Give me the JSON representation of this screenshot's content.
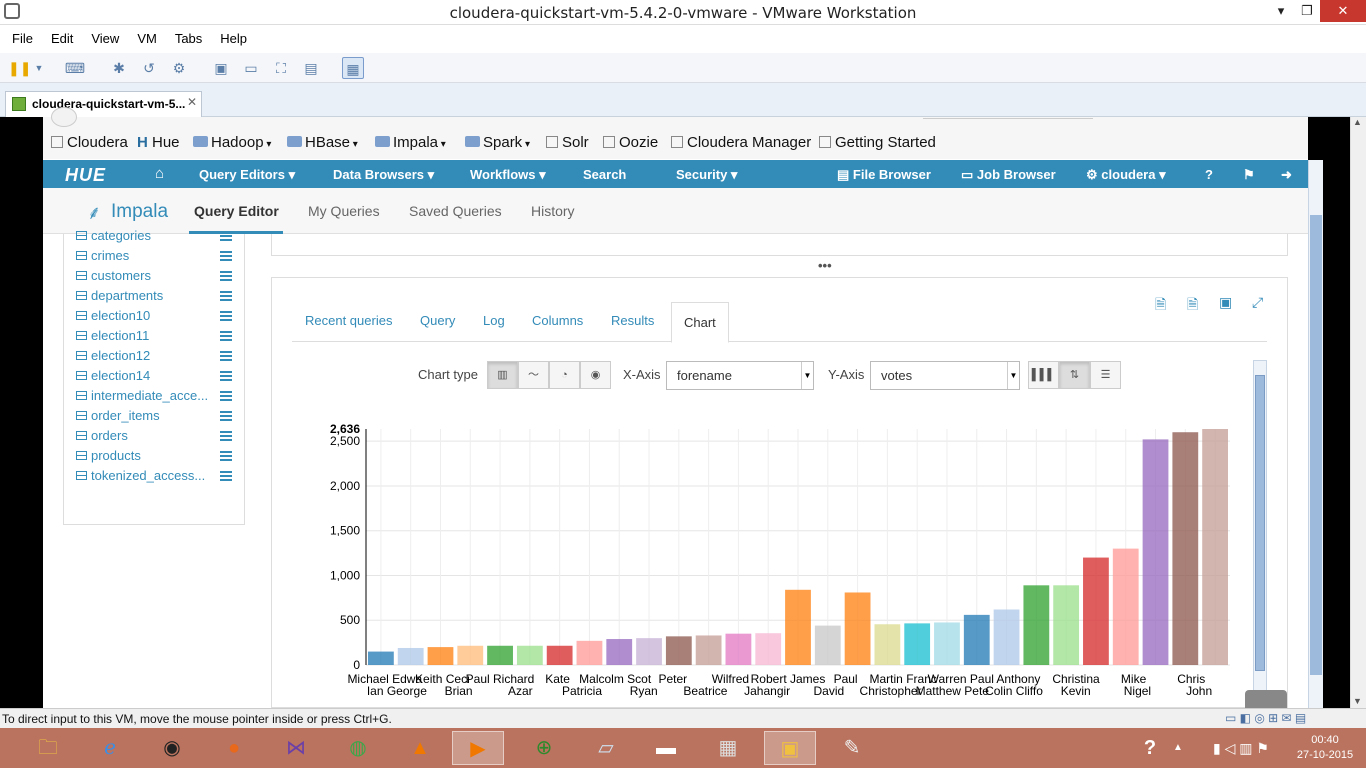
{
  "window": {
    "title": "cloudera-quickstart-vm-5.4.2-0-vmware - VMware Workstation",
    "minimize": "▾",
    "maximize": "❐",
    "close": "✕"
  },
  "menu": [
    "File",
    "Edit",
    "View",
    "VM",
    "Tabs",
    "Help"
  ],
  "vm_tab": {
    "label": "cloudera-quickstart-vm-5...",
    "close": "✕"
  },
  "bookmarks": [
    "Cloudera",
    "Hue",
    "Hadoop",
    "HBase",
    "Impala",
    "Spark",
    "Solr",
    "Oozie",
    "Cloudera Manager",
    "Getting Started"
  ],
  "hue_nav": {
    "logo": "HUE",
    "query_editors": "Query Editors ▾",
    "data_browsers": "Data Browsers ▾",
    "workflows": "Workflows ▾",
    "search": "Search",
    "security": "Security ▾",
    "file_browser": "File Browser",
    "job_browser": "Job Browser",
    "user": "cloudera ▾",
    "help": "?"
  },
  "sub_nav": {
    "app": "Impala",
    "query_editor": "Query Editor",
    "my_queries": "My Queries",
    "saved_queries": "Saved Queries",
    "history": "History"
  },
  "tables": [
    "categories",
    "crimes",
    "customers",
    "departments",
    "election10",
    "election11",
    "election12",
    "election14",
    "intermediate_acce...",
    "order_items",
    "orders",
    "products",
    "tokenized_access..."
  ],
  "result_tabs": [
    "Recent queries",
    "Query",
    "Log",
    "Columns",
    "Results",
    "Chart"
  ],
  "chart_controls": {
    "chart_type_label": "Chart type",
    "xaxis_label": "X-Axis",
    "xaxis_value": "forename",
    "yaxis_label": "Y-Axis",
    "yaxis_value": "votes"
  },
  "chart_data": {
    "type": "bar",
    "ylim": [
      0,
      2636
    ],
    "y_ticks": [
      "0",
      "500",
      "1,000",
      "1,500",
      "2,000",
      "2,500"
    ],
    "max_label": "2,636",
    "grid": true,
    "categories": [
      "Michael Edwa",
      "Ian George",
      "Keith Ceci",
      "Paul Brian",
      "Richard Azar",
      "Kate Patricia",
      "Malcolm Scot",
      "Ryan",
      "Peter Beatrice",
      "Wilfred Jahangir",
      "Robert James",
      "David",
      "Paul Christopher",
      "Martin Francis",
      "Matthew Pete",
      "Warren Colin",
      "Paul Cliffo",
      "Anthony Kevin",
      "Christina",
      "Nigel",
      "Mike",
      "John",
      "Chris"
    ],
    "values": [
      150,
      190,
      200,
      215,
      215,
      215,
      215,
      270,
      290,
      300,
      320,
      330,
      350,
      355,
      840,
      440,
      810,
      455,
      465,
      475,
      560,
      620,
      890,
      890,
      1200,
      1300,
      2520,
      2600,
      2636
    ],
    "colors": [
      "#1f77b4",
      "#aec7e8",
      "#ff7f0e",
      "#ffbb78",
      "#2ca02c",
      "#98df8a",
      "#d62728",
      "#ff9896",
      "#9467bd",
      "#c5b0d5",
      "#8c564b",
      "#c49c94",
      "#e377c2",
      "#f7b6d2",
      "#ff7f0e",
      "#c7c7c7",
      "#ff7f0e",
      "#dbdb8d",
      "#17becf",
      "#9edae5",
      "#1f77b4",
      "#aec7e8",
      "#2ca02c",
      "#98df8a",
      "#d62728",
      "#ff9896",
      "#9467bd",
      "#8c564b",
      "#c49c94"
    ],
    "labels_row1": [
      "Michael Edwa",
      "Keith Ceci",
      "Paul Richard",
      "Kate",
      "Malcolm Scot",
      "Peter",
      "Wilfred",
      "Robert James",
      "Paul",
      "Martin Franc",
      "Warren Paul",
      "Anthony",
      "Christina",
      "Mike",
      "Chris"
    ],
    "labels_row2": [
      "Ian George",
      "Brian",
      "Azar",
      "Patricia",
      "Ryan",
      "Beatrice",
      "Jahangir",
      "David",
      "Christopher",
      "Matthew Pete",
      "Colin Cliffo",
      "Kevin",
      "Nigel",
      "John"
    ]
  },
  "status_bar": "To direct input to this VM, move the mouse pointer inside or press Ctrl+G.",
  "clock": {
    "time": "00:40",
    "date": "27-10-2015"
  }
}
